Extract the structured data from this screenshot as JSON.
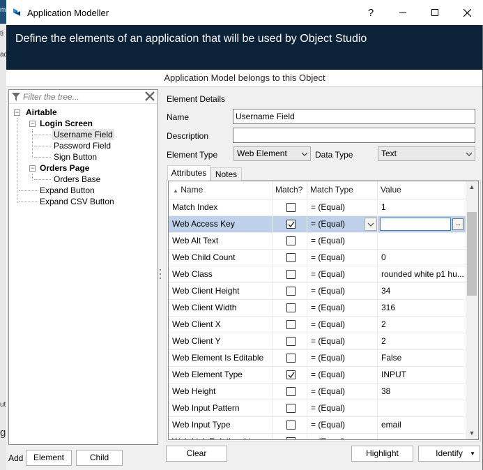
{
  "background_app": {
    "fragments": [
      "m",
      "ti",
      "ad",
      "ut",
      "g"
    ]
  },
  "window": {
    "title": "Application Modeller",
    "help_label": "?",
    "minimize_label": "—",
    "maximize_label": "☐",
    "close_label": "✕"
  },
  "banner": {
    "text": "Define the elements of an application that will be used by Object Studio"
  },
  "section_header": "Application Model belongs to this Object",
  "tree": {
    "filter_placeholder": "Filter the tree...",
    "nodes": [
      {
        "label": "Airtable"
      },
      {
        "label": "Login Screen"
      },
      {
        "label": "Username Field"
      },
      {
        "label": "Password Field"
      },
      {
        "label": "Sign Button"
      },
      {
        "label": "Orders Page"
      },
      {
        "label": "Orders Base"
      },
      {
        "label": "Expand Button"
      },
      {
        "label": "Expand CSV Button"
      }
    ],
    "selected_node": "Username Field"
  },
  "bottom_left": {
    "add_label": "Add",
    "element_label": "Element",
    "child_label": "Child"
  },
  "details": {
    "section_label": "Element Details",
    "name_label": "Name",
    "name_value": "Username Field",
    "description_label": "Description",
    "description_value": "",
    "element_type_label": "Element Type",
    "element_type_value": "Web Element",
    "data_type_label": "Data Type",
    "data_type_value": "Text"
  },
  "tabs": [
    {
      "label": "Attributes",
      "active": true
    },
    {
      "label": "Notes",
      "active": false
    }
  ],
  "grid": {
    "columns": {
      "name": "Name",
      "match": "Match?",
      "match_type": "Match Type",
      "value": "Value"
    },
    "sort_indicator": "▲",
    "rows": [
      {
        "name": "Match Index",
        "match": false,
        "match_type": "=  (Equal)",
        "value": "1"
      },
      {
        "name": "Web Access Key",
        "match": true,
        "match_type": "=  (Equal)",
        "value": "",
        "selected": true
      },
      {
        "name": "Web Alt Text",
        "match": false,
        "match_type": "=  (Equal)",
        "value": ""
      },
      {
        "name": "Web Child Count",
        "match": false,
        "match_type": "=  (Equal)",
        "value": "0"
      },
      {
        "name": "Web Class",
        "match": false,
        "match_type": "=  (Equal)",
        "value": "rounded white p1 hu..."
      },
      {
        "name": "Web Client Height",
        "match": false,
        "match_type": "=  (Equal)",
        "value": "34"
      },
      {
        "name": "Web Client Width",
        "match": false,
        "match_type": "=  (Equal)",
        "value": "316"
      },
      {
        "name": "Web Client X",
        "match": false,
        "match_type": "=  (Equal)",
        "value": "2"
      },
      {
        "name": "Web Client Y",
        "match": false,
        "match_type": "=  (Equal)",
        "value": "2"
      },
      {
        "name": "Web Element Is Editable",
        "match": false,
        "match_type": "=  (Equal)",
        "value": "False"
      },
      {
        "name": "Web Element Type",
        "match": true,
        "match_type": "=  (Equal)",
        "value": "INPUT"
      },
      {
        "name": "Web Height",
        "match": false,
        "match_type": "=  (Equal)",
        "value": "38"
      },
      {
        "name": "Web Input Pattern",
        "match": false,
        "match_type": "=  (Equal)",
        "value": ""
      },
      {
        "name": "Web Input Type",
        "match": false,
        "match_type": "=  (Equal)",
        "value": "email"
      },
      {
        "name": "Web Link Relationship",
        "match": false,
        "match_type": "=  (Equal)",
        "value": ""
      }
    ],
    "value_ellipsis": "..."
  },
  "footer_buttons": {
    "clear": "Clear",
    "highlight": "Highlight",
    "identify": "Identify"
  },
  "colors": {
    "banner": "#0b2239",
    "selection": "#bfd1ea",
    "accent": "#0078d7"
  }
}
